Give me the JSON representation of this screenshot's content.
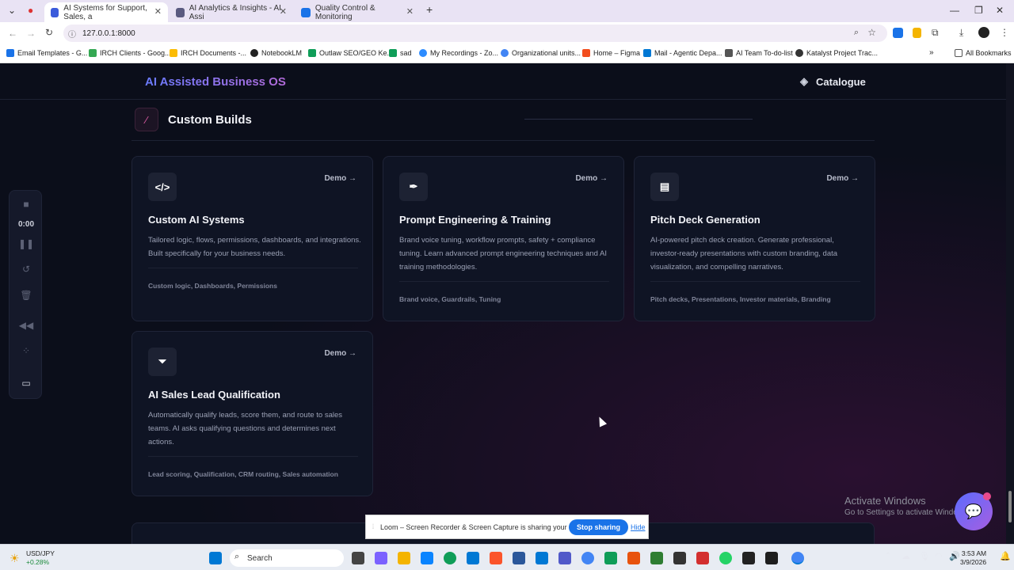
{
  "browser": {
    "tabs": [
      {
        "label": "AI Systems for Support, Sales, a",
        "active": true
      },
      {
        "label": "AI Analytics & Insights - AI Assi",
        "active": false
      },
      {
        "label": "Quality Control & Monitoring",
        "active": false
      }
    ],
    "url": "127.0.0.1:8000",
    "bookmarks": [
      "Email Templates - G...",
      "IRCH Clients - Goog...",
      "IRCH Documents -...",
      "NotebookLM",
      "Outlaw SEO/GEO Ke...",
      "sad",
      "My Recordings - Zo...",
      "Organizational units...",
      "Home – Figma",
      "Mail - Agentic Depa...",
      "AI Team To-do-list",
      "Katalyst Project Trac..."
    ],
    "all_bookmarks": "All Bookmarks"
  },
  "nav": {
    "brand": "AI Assisted Business OS",
    "catalogue": "Catalogue"
  },
  "section": {
    "title": "Custom Builds"
  },
  "cards": [
    {
      "icon": "</>",
      "demo": "Demo →",
      "title": "Custom AI Systems",
      "desc": "Tailored logic, flows, permissions, dashboards, and integrations. Built specifically for your business needs.",
      "tags": "Custom logic, Dashboards, Permissions"
    },
    {
      "icon": "✒",
      "demo": "Demo →",
      "title": "Prompt Engineering & Training",
      "desc": "Brand voice tuning, workflow prompts, safety + compliance tuning. Learn advanced prompt engineering techniques and AI training methodologies.",
      "tags": "Brand voice, Guardrails, Tuning"
    },
    {
      "icon": "▤",
      "demo": "Demo →",
      "title": "Pitch Deck Generation",
      "desc": "AI-powered pitch deck creation. Generate professional, investor-ready presentations with custom branding, data visualization, and compelling narratives.",
      "tags": "Pitch decks, Presentations, Investor materials, Branding"
    },
    {
      "icon": "⏷",
      "demo": "Demo →",
      "title": "AI Sales Lead Qualification",
      "desc": "Automatically qualify leads, score them, and route to sales teams. AI asks qualifying questions and determines next actions.",
      "tags": "Lead scoring, Qualification, CRM routing, Sales automation"
    }
  ],
  "recorder": {
    "time": "0:00"
  },
  "windows_notice": {
    "line1": "Activate Windows",
    "line2": "Go to Settings to activate Windows."
  },
  "loom": {
    "message": "Loom – Screen Recorder & Screen Capture is sharing your screen.",
    "stop": "Stop sharing",
    "hide": "Hide"
  },
  "taskbar": {
    "ticker_name": "USD/JPY",
    "ticker_change": "+0.28%",
    "search": "Search",
    "time": "3:53 AM",
    "date": "3/9/2026"
  },
  "colors": {
    "accent": "#6a7bff",
    "brand_end": "#b26bd9",
    "section_icon": "#e25ea8",
    "background": "#0b0e1a"
  }
}
